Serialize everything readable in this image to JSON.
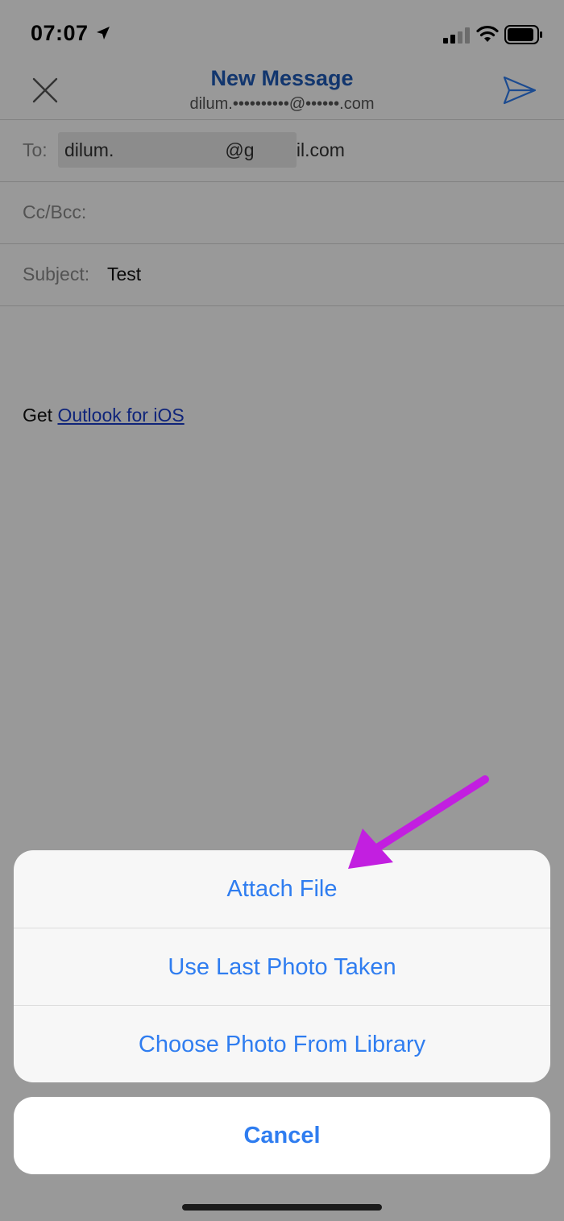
{
  "status": {
    "time": "07:07"
  },
  "header": {
    "title": "New Message",
    "account": "dilum.••••••••••@••••••.com"
  },
  "fields": {
    "to_label": "To:",
    "to_value": "dilum.      @g   il.com",
    "cc_label": "Cc/Bcc:",
    "subject_label": "Subject:",
    "subject_value": "Test"
  },
  "body": {
    "prefix": "Get ",
    "link_text": "Outlook for iOS"
  },
  "action_sheet": {
    "items": [
      "Attach File",
      "Use Last Photo Taken",
      "Choose Photo From Library"
    ],
    "cancel": "Cancel"
  },
  "colors": {
    "accent": "#2f7df0",
    "title": "#1e5bb8",
    "arrow": "#c21fe0"
  }
}
